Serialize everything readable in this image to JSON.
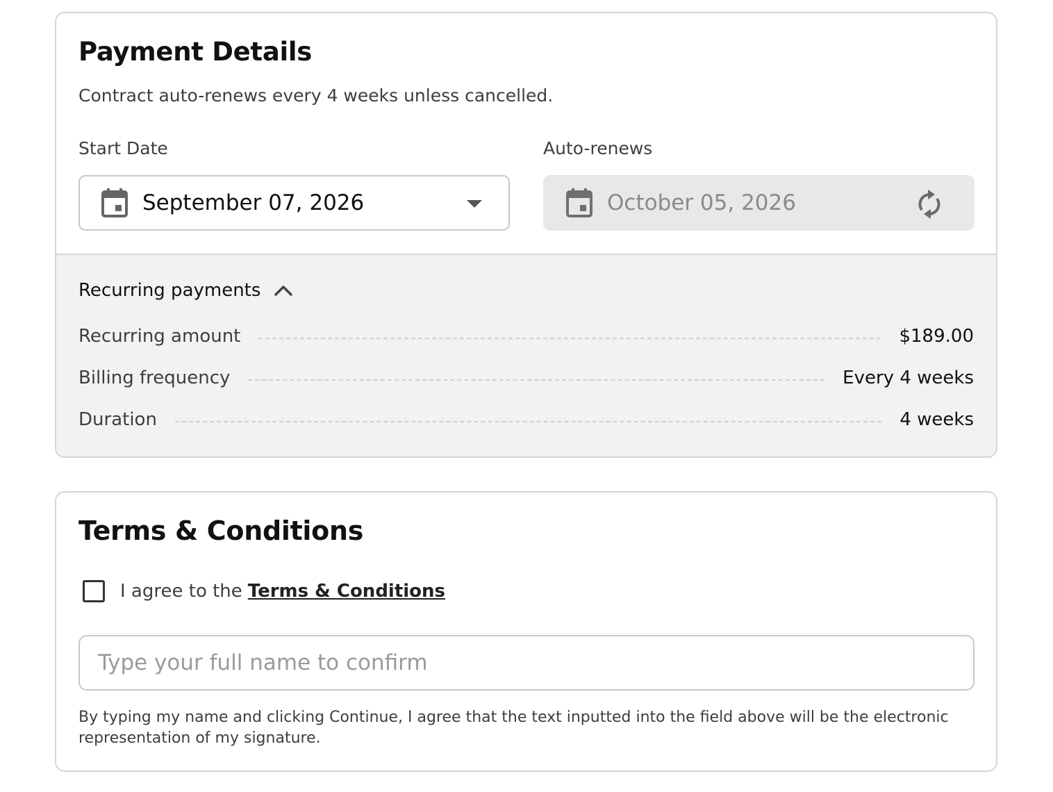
{
  "payment": {
    "title": "Payment Details",
    "subtitle": "Contract auto-renews every 4 weeks unless cancelled.",
    "start_date": {
      "label": "Start Date",
      "value": "September 07, 2026"
    },
    "auto_renews": {
      "label": "Auto-renews",
      "value": "October 05, 2026"
    },
    "recurring": {
      "toggle_label": "Recurring payments",
      "rows": [
        {
          "label": "Recurring amount",
          "value": "$189.00"
        },
        {
          "label": "Billing frequency",
          "value": "Every 4 weeks"
        },
        {
          "label": "Duration",
          "value": "4 weeks"
        }
      ]
    }
  },
  "terms": {
    "title": "Terms & Conditions",
    "agree_prefix": "I agree to the",
    "agree_link": "Terms & Conditions",
    "agree_checked": false,
    "name_placeholder": "Type your full name to confirm",
    "name_value": "",
    "disclaimer": "By typing my name and clicking Continue, I agree that the text inputted into the field above will be the electronic representation of my signature."
  },
  "icons": {
    "calendar": "calendar-icon",
    "dropdown": "chevron-down-icon",
    "renew": "renew-icon",
    "collapse": "chevron-up-icon"
  },
  "colors": {
    "text_primary": "#111111",
    "text_secondary": "#3e3e3e",
    "text_disabled": "#8a8a8a",
    "border": "#d6d6d6",
    "panel_bg": "#f2f2f2",
    "disabled_field_bg": "#e8e8e8"
  }
}
